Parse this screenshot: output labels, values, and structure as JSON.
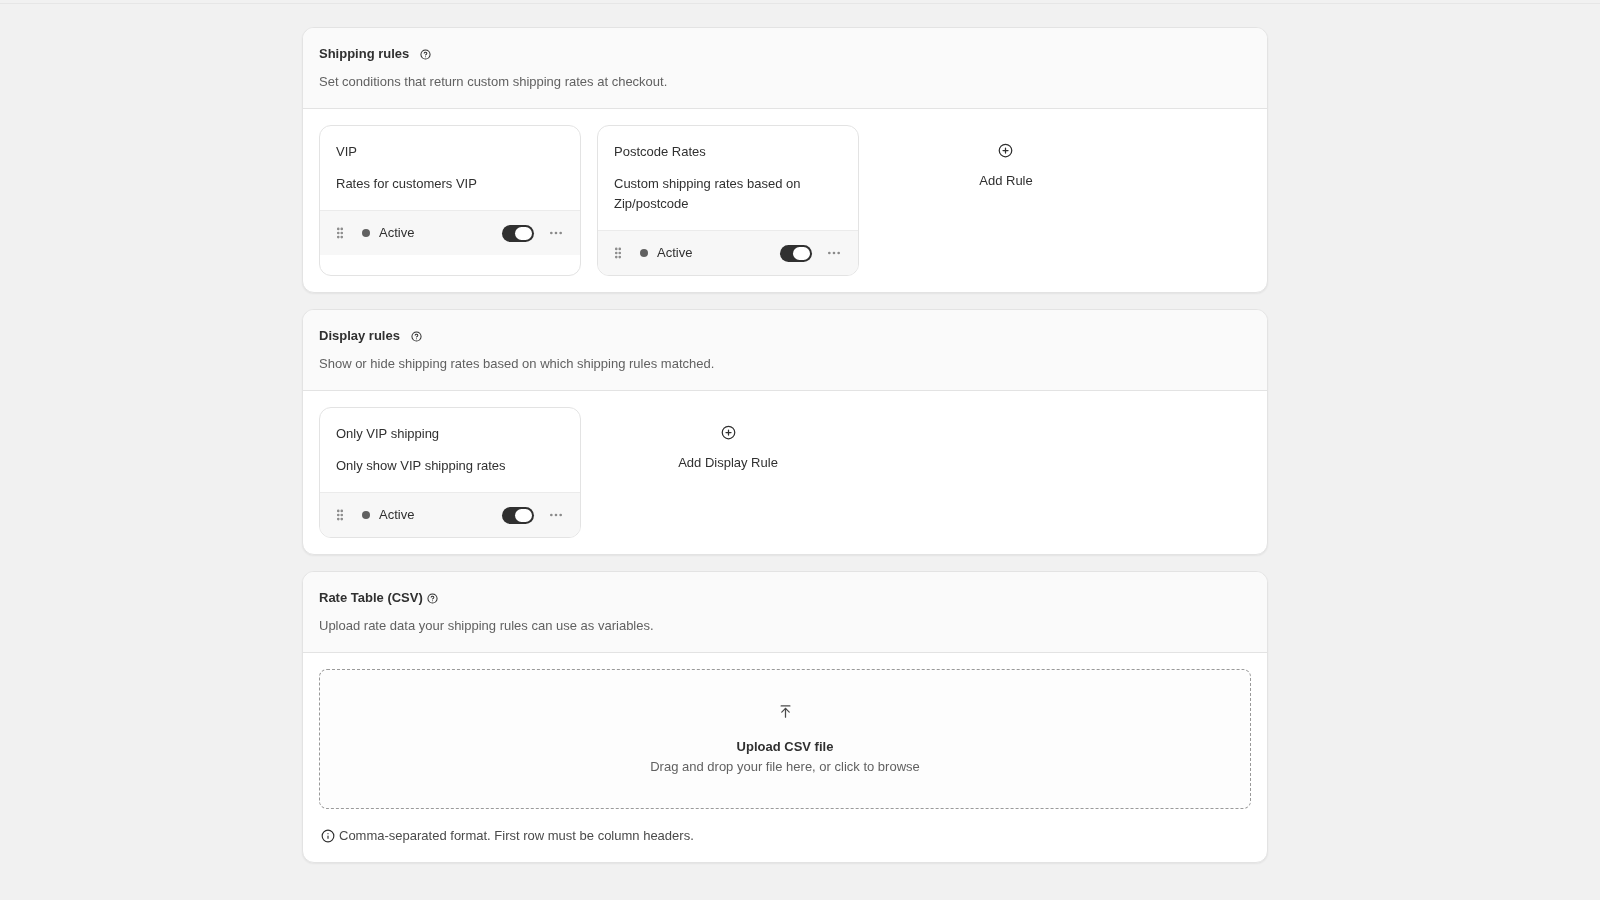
{
  "sections": [
    {
      "kind": "rules",
      "title": "Shipping rules",
      "description": "Set conditions that return custom shipping rates at checkout.",
      "rules": [
        {
          "name": "VIP",
          "description": "Rates for customers VIP",
          "status": "Active",
          "on": true
        },
        {
          "name": "Postcode Rates",
          "description": "Custom shipping rates based on Zip/postcode",
          "status": "Active",
          "on": true
        }
      ],
      "add_label": "Add Rule"
    },
    {
      "kind": "rules",
      "title": "Display rules",
      "description": "Show or hide shipping rates based on which shipping rules matched.",
      "rules": [
        {
          "name": "Only VIP shipping",
          "description": "Only show VIP shipping rates",
          "status": "Active",
          "on": true
        }
      ],
      "add_label": "Add Display Rule"
    },
    {
      "kind": "upload",
      "title": "Rate Table (CSV)",
      "description": "Upload rate data your shipping rules can use as variables.",
      "upload_title": "Upload CSV file",
      "upload_hint": "Drag and drop your file here, or click to browse",
      "note": "Comma-separated format. First row must be column headers."
    }
  ]
}
